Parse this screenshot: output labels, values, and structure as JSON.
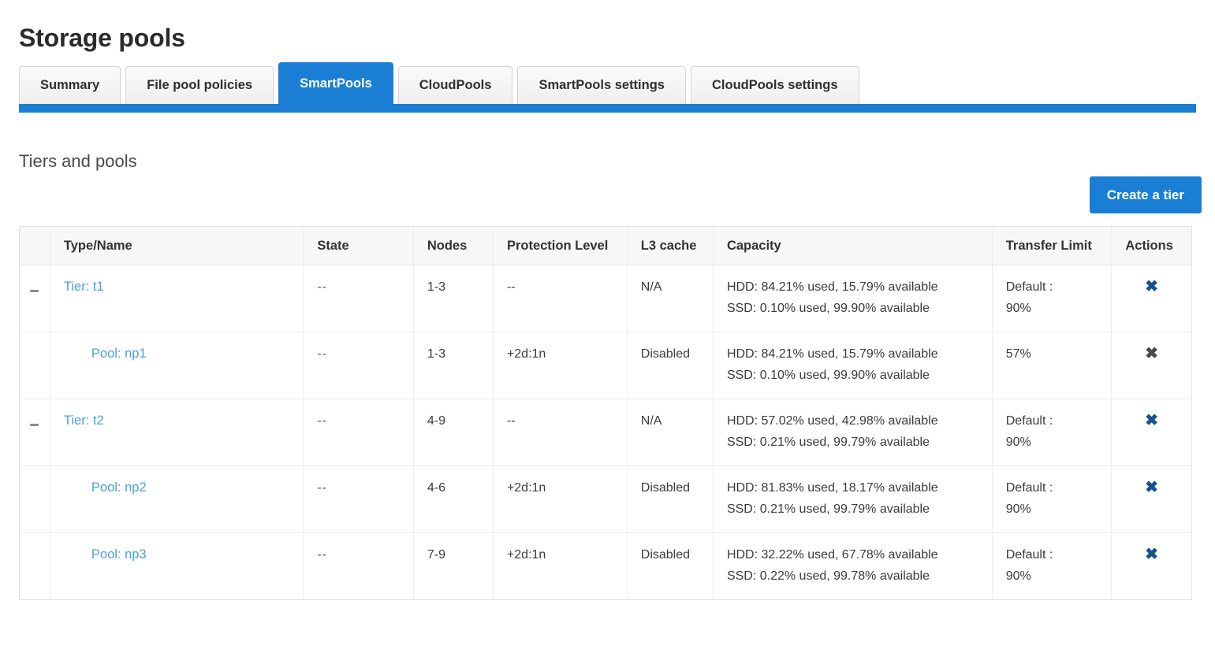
{
  "page": {
    "title": "Storage pools",
    "section_title": "Tiers and pools"
  },
  "tabs": [
    {
      "label": "Summary",
      "active": false
    },
    {
      "label": "File pool policies",
      "active": false
    },
    {
      "label": "SmartPools",
      "active": true
    },
    {
      "label": "CloudPools",
      "active": false
    },
    {
      "label": "SmartPools settings",
      "active": false
    },
    {
      "label": "CloudPools settings",
      "active": false
    }
  ],
  "toolbar": {
    "create_tier_label": "Create a tier"
  },
  "table": {
    "headers": {
      "type_name": "Type/Name",
      "state": "State",
      "nodes": "Nodes",
      "protection_level": "Protection Level",
      "l3_cache": "L3 cache",
      "capacity": "Capacity",
      "transfer_limit": "Transfer Limit",
      "actions": "Actions"
    },
    "rows": [
      {
        "kind": "tier",
        "name": "Tier: t1",
        "state": "--",
        "nodes": "1-3",
        "protection_level": "--",
        "l3_cache": "N/A",
        "capacity_hdd": "HDD: 84.21% used, 15.79% available",
        "capacity_ssd": "SSD: 0.10% used, 99.90% available",
        "transfer_limit_line1": "Default :",
        "transfer_limit_line2": "90%",
        "action": "✖"
      },
      {
        "kind": "pool",
        "name": "Pool: np1",
        "state": "--",
        "nodes": "1-3",
        "protection_level": "+2d:1n",
        "l3_cache": "Disabled",
        "capacity_hdd": "HDD: 84.21% used, 15.79% available",
        "capacity_ssd": "SSD: 0.10% used, 99.90% available",
        "transfer_limit_line1": "57%",
        "transfer_limit_line2": "",
        "action": "✖"
      },
      {
        "kind": "tier",
        "name": "Tier: t2",
        "state": "--",
        "nodes": "4-9",
        "protection_level": "--",
        "l3_cache": "N/A",
        "capacity_hdd": "HDD: 57.02% used, 42.98% available",
        "capacity_ssd": "SSD: 0.21% used, 99.79% available",
        "transfer_limit_line1": "Default :",
        "transfer_limit_line2": "90%",
        "action": "✖"
      },
      {
        "kind": "pool",
        "name": "Pool: np2",
        "state": "--",
        "nodes": "4-6",
        "protection_level": "+2d:1n",
        "l3_cache": "Disabled",
        "capacity_hdd": "HDD: 81.83% used, 18.17% available",
        "capacity_ssd": "SSD: 0.21% used, 99.79% available",
        "transfer_limit_line1": "Default :",
        "transfer_limit_line2": "90%",
        "action": "✖"
      },
      {
        "kind": "pool",
        "name": "Pool: np3",
        "state": "--",
        "nodes": "7-9",
        "protection_level": "+2d:1n",
        "l3_cache": "Disabled",
        "capacity_hdd": "HDD: 32.22% used, 67.78% available",
        "capacity_ssd": "SSD: 0.22% used, 99.78% available",
        "transfer_limit_line1": "Default :",
        "transfer_limit_line2": "90%",
        "action": "✖"
      }
    ]
  },
  "colors": {
    "accent_blue": "#1a7fd4",
    "link_blue": "#4a9fe0",
    "action_icon": "#14538f"
  }
}
